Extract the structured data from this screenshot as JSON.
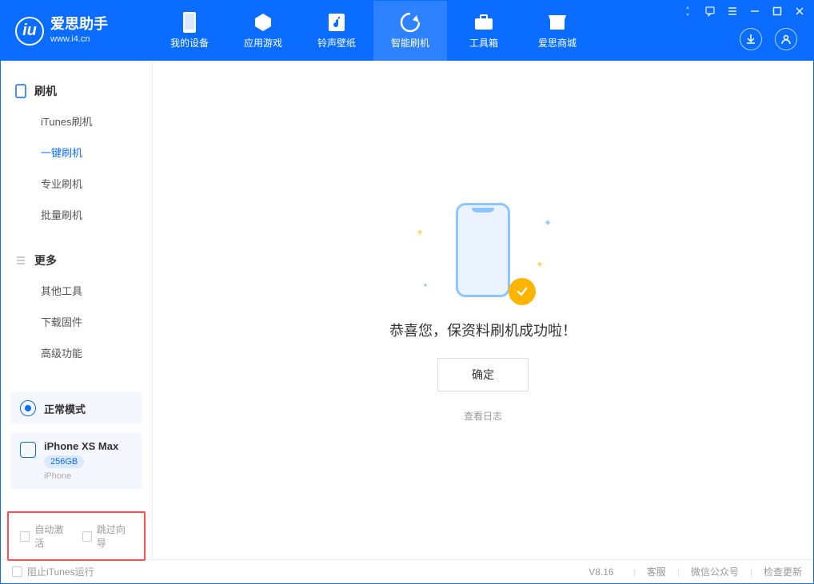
{
  "app": {
    "name": "爱思助手",
    "domain": "www.i4.cn"
  },
  "nav": {
    "tabs": [
      {
        "label": "我的设备"
      },
      {
        "label": "应用游戏"
      },
      {
        "label": "铃声壁纸"
      },
      {
        "label": "智能刷机"
      },
      {
        "label": "工具箱"
      },
      {
        "label": "爱思商城"
      }
    ]
  },
  "sidebar": {
    "groups": [
      {
        "title": "刷机",
        "items": [
          {
            "label": "iTunes刷机"
          },
          {
            "label": "一键刷机"
          },
          {
            "label": "专业刷机"
          },
          {
            "label": "批量刷机"
          }
        ]
      },
      {
        "title": "更多",
        "items": [
          {
            "label": "其他工具"
          },
          {
            "label": "下载固件"
          },
          {
            "label": "高级功能"
          }
        ]
      }
    ],
    "status": {
      "label": "正常模式"
    },
    "device": {
      "name": "iPhone XS Max",
      "storage": "256GB",
      "type": "iPhone"
    },
    "options": {
      "auto_activate": "自动激活",
      "skip_guide": "跳过向导"
    }
  },
  "main": {
    "success_message": "恭喜您，保资料刷机成功啦！",
    "ok_button": "确定",
    "view_log": "查看日志"
  },
  "footer": {
    "block_itunes": "阻止iTunes运行",
    "version": "V8.16",
    "support": "客服",
    "wechat": "微信公众号",
    "check_update": "检查更新"
  }
}
